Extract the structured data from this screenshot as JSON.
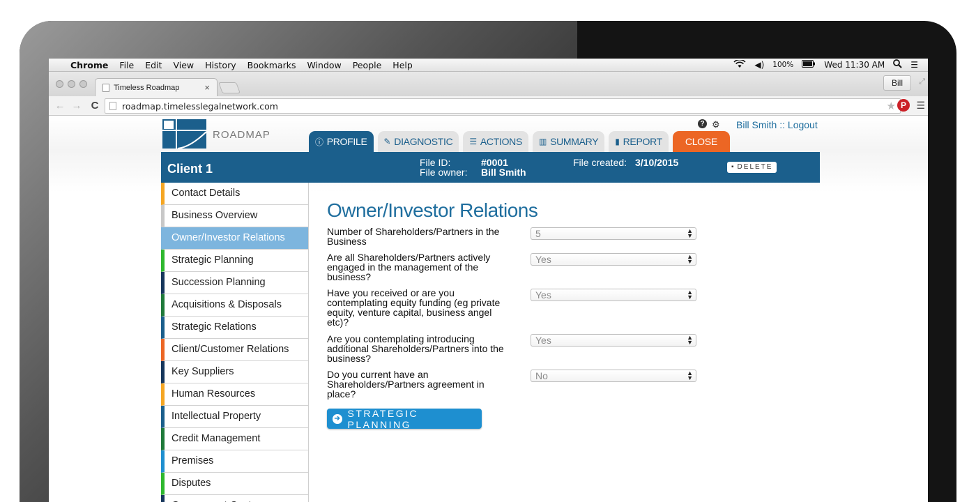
{
  "menubar": {
    "app": "Chrome",
    "items": [
      "File",
      "Edit",
      "View",
      "History",
      "Bookmarks",
      "Window",
      "People",
      "Help"
    ],
    "battery": "100%",
    "clock": "Wed 11:30 AM"
  },
  "browser": {
    "tab_title": "Timeless Roadmap",
    "profile": "Bill",
    "url": "roadmap.timelesslegalnetwork.com"
  },
  "app": {
    "logo_text": "ROADMAP",
    "tabs": [
      {
        "label": "PROFILE",
        "icon": "info-icon"
      },
      {
        "label": "DIAGNOSTIC",
        "icon": "edit-icon"
      },
      {
        "label": "ACTIONS",
        "icon": "list-icon"
      },
      {
        "label": "SUMMARY",
        "icon": "bar-chart-icon"
      },
      {
        "label": "REPORT",
        "icon": "document-icon"
      },
      {
        "label": "CLOSE",
        "icon": ""
      }
    ],
    "user_link": "Bill Smith :: Logout",
    "accent_color": "#1b5f8c",
    "close_color": "#ec6624"
  },
  "client": {
    "name": "Client 1",
    "file_id_label": "File ID:",
    "file_id": "#0001",
    "file_owner_label": "File owner:",
    "file_owner": "Bill Smith",
    "file_created_label": "File created:",
    "file_created": "3/10/2015",
    "delete_label": "DELETE"
  },
  "sidebar": {
    "items": [
      {
        "label": "Contact Details",
        "color": "#f5a623"
      },
      {
        "label": "Business Overview",
        "color": "#c8c8c8"
      },
      {
        "label": "Owner/Investor Relations",
        "color": "#7db5de",
        "active": true
      },
      {
        "label": "Strategic Planning",
        "color": "#2eb82e"
      },
      {
        "label": "Succession Planning",
        "color": "#16365c"
      },
      {
        "label": "Acquisitions & Disposals",
        "color": "#1f7a3a"
      },
      {
        "label": "Strategic Relations",
        "color": "#1b5f8c"
      },
      {
        "label": "Client/Customer Relations",
        "color": "#ec6624"
      },
      {
        "label": "Key Suppliers",
        "color": "#16365c"
      },
      {
        "label": "Human Resources",
        "color": "#f5a623"
      },
      {
        "label": "Intellectual Property",
        "color": "#1b5f8c"
      },
      {
        "label": "Credit Management",
        "color": "#1f7a3a"
      },
      {
        "label": "Premises",
        "color": "#1e8fd0"
      },
      {
        "label": "Disputes",
        "color": "#2eb82e"
      },
      {
        "label": "Government Cont...",
        "color": "#16365c"
      }
    ]
  },
  "form": {
    "title": "Owner/Investor Relations",
    "questions": [
      {
        "text": "Number of Shareholders/Partners in the Business",
        "value": "5"
      },
      {
        "text": "Are all Shareholders/Partners actively engaged in the management of the business?",
        "value": "Yes"
      },
      {
        "text": "Have you received or are you contemplating equity funding (eg private equity, venture capital, business angel etc)?",
        "value": "Yes"
      },
      {
        "text": "Are you contemplating introducing additional Shareholders/Partners into the business?",
        "value": "Yes"
      },
      {
        "text": "Do you current have an Shareholders/Partners agreement in place?",
        "value": "No"
      }
    ],
    "next_button": "STRATEGIC PLANNING"
  }
}
